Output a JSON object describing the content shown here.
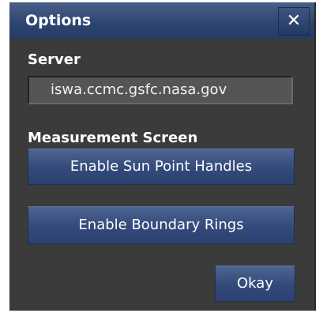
{
  "dialog": {
    "title": "Options",
    "close_label": "✕"
  },
  "server": {
    "label": "Server",
    "value": "iswa.ccmc.gsfc.nasa.gov"
  },
  "measurement": {
    "label": "Measurement Screen",
    "sun_point_button": "Enable Sun Point Handles",
    "boundary_rings_button": "Enable Boundary Rings"
  },
  "footer": {
    "okay_label": "Okay"
  },
  "colors": {
    "panel_background": "#3b3b3b",
    "titlebar_accent": "#2d4470",
    "button_accent": "#33497a",
    "field_background": "#555555",
    "text": "#ffffff"
  }
}
